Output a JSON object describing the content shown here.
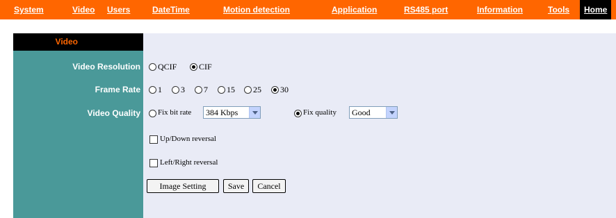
{
  "nav": {
    "items": [
      {
        "label": "System"
      },
      {
        "label": "Video"
      },
      {
        "label": "Users"
      },
      {
        "label": "DateTime"
      },
      {
        "label": "Motion detection"
      },
      {
        "label": "Application"
      },
      {
        "label": "RS485 port"
      },
      {
        "label": "Information"
      },
      {
        "label": "Tools"
      },
      {
        "label": "Home"
      }
    ]
  },
  "section": {
    "title": "Video"
  },
  "form": {
    "resolution": {
      "label": "Video Resolution",
      "options": [
        "QCIF",
        "CIF"
      ],
      "selected": "CIF"
    },
    "frame_rate": {
      "label": "Frame Rate",
      "options": [
        "1",
        "3",
        "7",
        "15",
        "25",
        "30"
      ],
      "selected": "30"
    },
    "quality": {
      "label": "Video Quality",
      "fix_bitrate_label": "Fix bit rate",
      "bitrate_value": "384 Kbps",
      "fix_quality_label": "Fix quality",
      "quality_value": "Good",
      "selected": "Fix quality"
    },
    "updown_label": "Up/Down reversal",
    "leftright_label": "Left/Right reversal",
    "buttons": {
      "image_setting": "Image Setting",
      "save": "Save",
      "cancel": "Cancel"
    }
  },
  "colors": {
    "nav_bg": "#ff6600",
    "side_bg": "#4a9999",
    "main_bg": "#e9ebf6",
    "title": "#ff6600"
  }
}
